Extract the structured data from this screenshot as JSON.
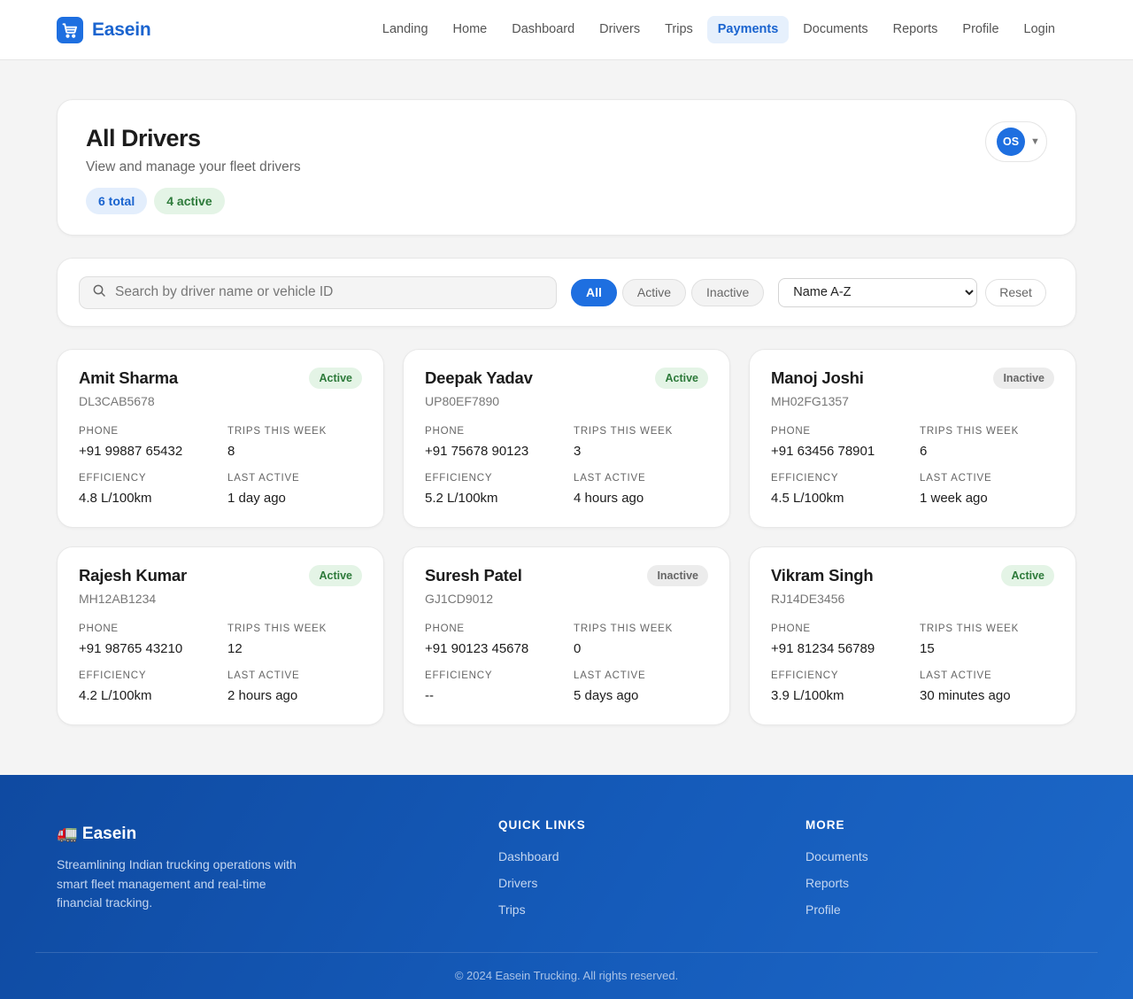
{
  "brand": {
    "name": "Easein"
  },
  "nav": [
    {
      "label": "Landing",
      "active": false
    },
    {
      "label": "Home",
      "active": false
    },
    {
      "label": "Dashboard",
      "active": false
    },
    {
      "label": "Drivers",
      "active": false
    },
    {
      "label": "Trips",
      "active": false
    },
    {
      "label": "Payments",
      "active": true
    },
    {
      "label": "Documents",
      "active": false
    },
    {
      "label": "Reports",
      "active": false
    },
    {
      "label": "Profile",
      "active": false
    },
    {
      "label": "Login",
      "active": false
    }
  ],
  "page": {
    "title": "All Drivers",
    "subtitle": "View and manage your fleet drivers",
    "total_badge": "6 total",
    "active_badge": "4 active",
    "user_initials": "OS"
  },
  "filters": {
    "search_placeholder": "Search by driver name or vehicle ID",
    "search_value": "",
    "segments": [
      {
        "label": "All",
        "selected": true
      },
      {
        "label": "Active",
        "selected": false
      },
      {
        "label": "Inactive",
        "selected": false
      }
    ],
    "sort_options": [
      "Name A-Z"
    ],
    "sort_selected": "Name A-Z",
    "reset_label": "Reset"
  },
  "field_labels": {
    "phone": "PHONE",
    "trips": "TRIPS THIS WEEK",
    "efficiency": "EFFICIENCY",
    "last_active": "LAST ACTIVE"
  },
  "drivers": [
    {
      "name": "Amit Sharma",
      "vehicle": "DL3CAB5678",
      "status": "Active",
      "phone": "+91 99887 65432",
      "trips": "8",
      "efficiency": "4.8 L/100km",
      "last_active": "1 day ago"
    },
    {
      "name": "Deepak Yadav",
      "vehicle": "UP80EF7890",
      "status": "Active",
      "phone": "+91 75678 90123",
      "trips": "3",
      "efficiency": "5.2 L/100km",
      "last_active": "4 hours ago"
    },
    {
      "name": "Manoj Joshi",
      "vehicle": "MH02FG1357",
      "status": "Inactive",
      "phone": "+91 63456 78901",
      "trips": "6",
      "efficiency": "4.5 L/100km",
      "last_active": "1 week ago"
    },
    {
      "name": "Rajesh Kumar",
      "vehicle": "MH12AB1234",
      "status": "Active",
      "phone": "+91 98765 43210",
      "trips": "12",
      "efficiency": "4.2 L/100km",
      "last_active": "2 hours ago"
    },
    {
      "name": "Suresh Patel",
      "vehicle": "GJ1CD9012",
      "status": "Inactive",
      "phone": "+91 90123 45678",
      "trips": "0",
      "efficiency": "--",
      "last_active": "5 days ago"
    },
    {
      "name": "Vikram Singh",
      "vehicle": "RJ14DE3456",
      "status": "Active",
      "phone": "+91 81234 56789",
      "trips": "15",
      "efficiency": "3.9 L/100km",
      "last_active": "30 minutes ago"
    }
  ],
  "footer": {
    "brand": "🚛 Easein",
    "description": "Streamlining Indian trucking operations with smart fleet management and real-time financial tracking.",
    "quick_links_title": "QUICK LINKS",
    "quick_links": [
      "Dashboard",
      "Drivers",
      "Trips"
    ],
    "more_title": "MORE",
    "more_links": [
      "Documents",
      "Reports",
      "Profile"
    ],
    "copyright": "© 2024 Easein Trucking. All rights reserved."
  }
}
